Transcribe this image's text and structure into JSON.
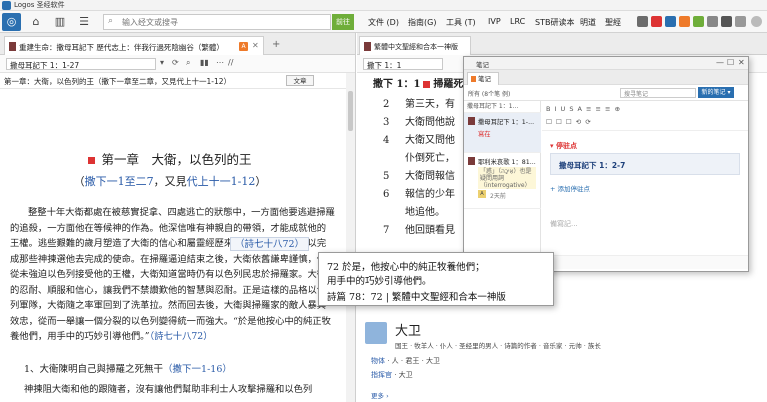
{
  "window": {
    "title": "Logos 圣经软件"
  },
  "toolbar": {
    "search_placeholder": "输入经文或搜寻",
    "go_label": "前往",
    "menus": [
      "文件 (D)",
      "指南(G)",
      "工具 (T)"
    ],
    "bible_versions": [
      "IVP",
      "LRC",
      "STB研读本",
      "明道",
      "聖經"
    ]
  },
  "left_panel": {
    "tabs": [
      {
        "label": "重建生命：撒母耳記下 歷代志上：伴我行過死陰幽谷（繁體）",
        "badge": "A"
      }
    ],
    "reference": "撒母耳記下 1：1-27",
    "breadcrumb": "第一章：大衛，以色列的王（撒下一章至二章，又見代上十一1-12）",
    "doc_button": "文章",
    "chapter_title": "第一章　大衛，以色列的王",
    "chapter_sub_prefix": "（",
    "chapter_sub_ref1": "撒下一1至二7",
    "chapter_sub_mid": "，又見",
    "chapter_sub_ref2": "代上十一1-12",
    "chapter_sub_suffix": "）",
    "body_part1": "整整十年大衛都處在被慈實捉拿、四處逃亡的狀態中，一方面他要逃避掃羅的追殺，一方面他在等候神的作為。他深信唯有神親自的帶領，才能成就他的王權。逃些艱難的歲月塑造了大衛的信心和屬靈",
    "body_part2": "經歷來裝備大衛，使他能以完成那些神揀選他去完成的使命。在掃羅逼迫結束之後，大衛依舊謙卑謹慎，他從未強迫以色列接受他的王權，大衛知道當時仍有以色列民忠於掃羅家。大衛的忍耐、順服和信心，讓我們不禁讚歎他的智慧與忍耐。正是這樣的品格以色列軍隊，大衛隨之率軍回到了洗革拉。然而回去後，大衛與掃羅家的敵人暴與效忠，從而一舉讓一個分裂的以色列變得統一而強大。",
    "body_quote": "“於是他按心中的純正牧養他們，用手中的巧妙引導他們。”",
    "body_ref": "（詩七十八72）",
    "section_heading": "1、大衛陳明自己與掃羅之死無干",
    "section_heading_ref": "（撒下一1-16）",
    "section_body": "神揀阻大衛和他的跟隨者，沒有讓他們幫助非利士人攻擊掃羅和以色列"
  },
  "right_panel": {
    "tab_label": "繁體中文聖經和合本一神版",
    "reference": "撒下 1：1",
    "heading": "撒下 1：1",
    "heading_text": "掃羅死後，",
    "verses": [
      {
        "num": "2",
        "text": "第三天，有"
      },
      {
        "num": "3",
        "text": "大衛問他說"
      },
      {
        "num": "4",
        "text": "大衛又問他"
      },
      {
        "num": "",
        "text": "仆倒死亡，"
      },
      {
        "num": "5",
        "text": "大衛問報信"
      },
      {
        "num": "6",
        "text": "報信的少年"
      },
      {
        "num": "",
        "text": "地追他。"
      },
      {
        "num": "7",
        "text": "他回頭看見"
      }
    ]
  },
  "notes": {
    "window_title": "笔记",
    "tab_label": "笔记",
    "list_label": "所有 (8个笔 例)",
    "search_placeholder": "搜寻笔记",
    "new_button": "新的笔记 ▾",
    "format_label": "撒母耳記下 1：1...",
    "items": [
      {
        "title": "撒母耳記下 1：1-...",
        "sub": "寫在"
      },
      {
        "title": "耶利米哀歌 1：81...",
        "highlight": "「惑」（אֵיכָה）也是疑問用詞（interrogative）",
        "time": "2天前",
        "avatar": "A"
      }
    ],
    "editor_toolbar_row1": "B I U S  A  ≡ ≡ ≡  ⊕",
    "editor_toolbar_row2": "☐ ☐ ☐ ⟲ ⟳",
    "anchor_title": "▾ 停驻点",
    "anchor_ref": "撒母耳記下 1：2-7",
    "add_anchor": "+ 添加停驻点",
    "placeholder": "備寫記..."
  },
  "tooltip": {
    "chip": "（詩七十八72）",
    "line1": "72 於是，他按心中的純正牧養他們；",
    "line2": "用手中的巧妙引導他們。",
    "line3": "詩篇 78：72 | 繁體中文聖經和合本一神版"
  },
  "dictionary": {
    "word": "大卫",
    "tags": "国王 · 牧羊人 · 仆人 · 圣经里的男人 · 诗篇的作者 · 音乐家 · 元帅 · 族长",
    "line1_label": "物体",
    "line1_rest": " · 人 · 君王 · 大卫",
    "line2_label": "指挥官",
    "line2_rest": " · 大卫",
    "more": "更多 ›"
  }
}
